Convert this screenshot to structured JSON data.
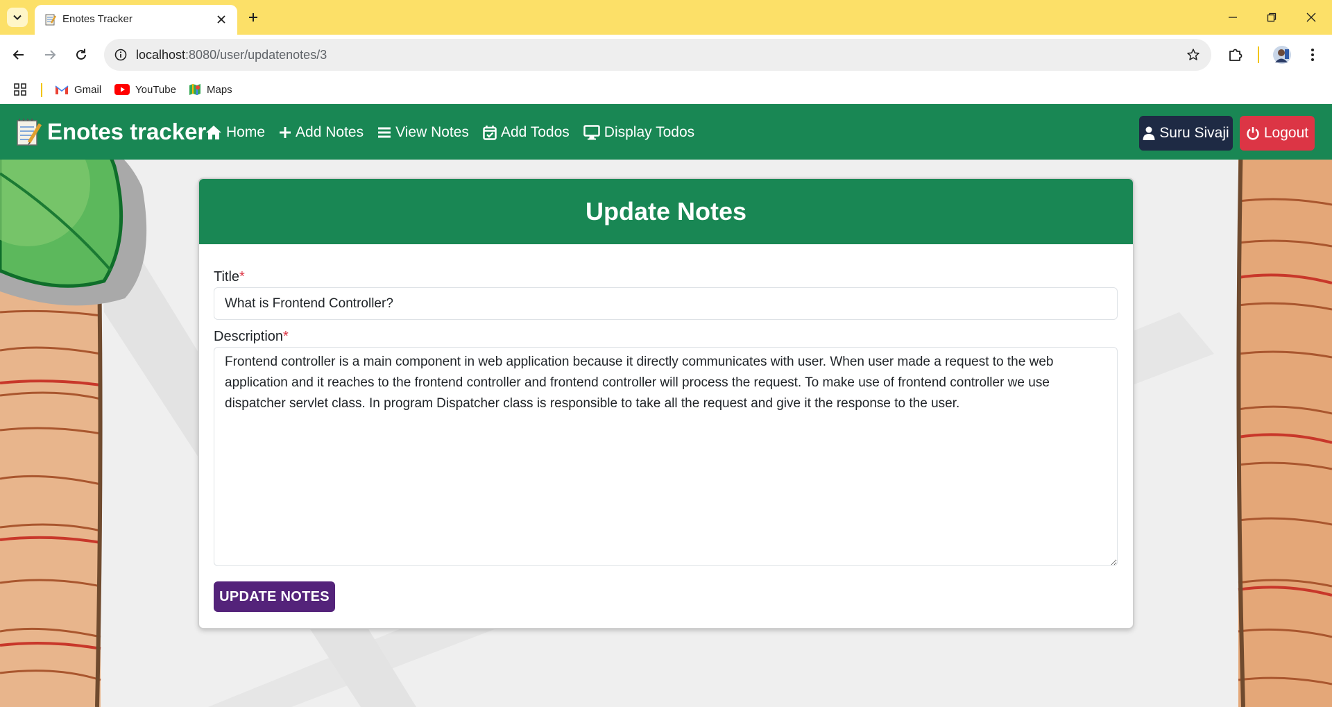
{
  "browser": {
    "tab_title": "Enotes Tracker",
    "url_host": "localhost",
    "url_path": ":8080/user/updatenotes/3",
    "bookmarks": [
      {
        "label": "Gmail",
        "icon": "gmail-icon"
      },
      {
        "label": "YouTube",
        "icon": "youtube-icon"
      },
      {
        "label": "Maps",
        "icon": "maps-icon"
      }
    ]
  },
  "navbar": {
    "brand": "Enotes tracker",
    "links": [
      {
        "label": "Home",
        "icon": "home-icon"
      },
      {
        "label": "Add Notes",
        "icon": "plus-icon"
      },
      {
        "label": "View Notes",
        "icon": "list-icon"
      },
      {
        "label": "Add Todos",
        "icon": "calendar-check-icon"
      },
      {
        "label": "Display Todos",
        "icon": "desktop-icon"
      }
    ],
    "user_label": "Suru Sivaji",
    "logout_label": "Logout",
    "colors": {
      "navbar": "#198754",
      "user_button": "#1e2a44",
      "logout_button": "#dc3545"
    }
  },
  "form": {
    "heading": "Update Notes",
    "title_label": "Title",
    "title_value": "What is Frontend Controller?",
    "required_mark": "*",
    "description_label": "Description",
    "description_value": "Frontend controller is a main component in web application because it directly communicates with user. When user made a request to the web application and it reaches to the frontend controller and frontend controller will process the request. To make use of frontend controller we use dispatcher servlet class. In program Dispatcher class is responsible to take all the request and give it the response to the user.",
    "submit_label": "UPDATE NOTES",
    "colors": {
      "header": "#198754",
      "submit": "#54237a"
    }
  }
}
